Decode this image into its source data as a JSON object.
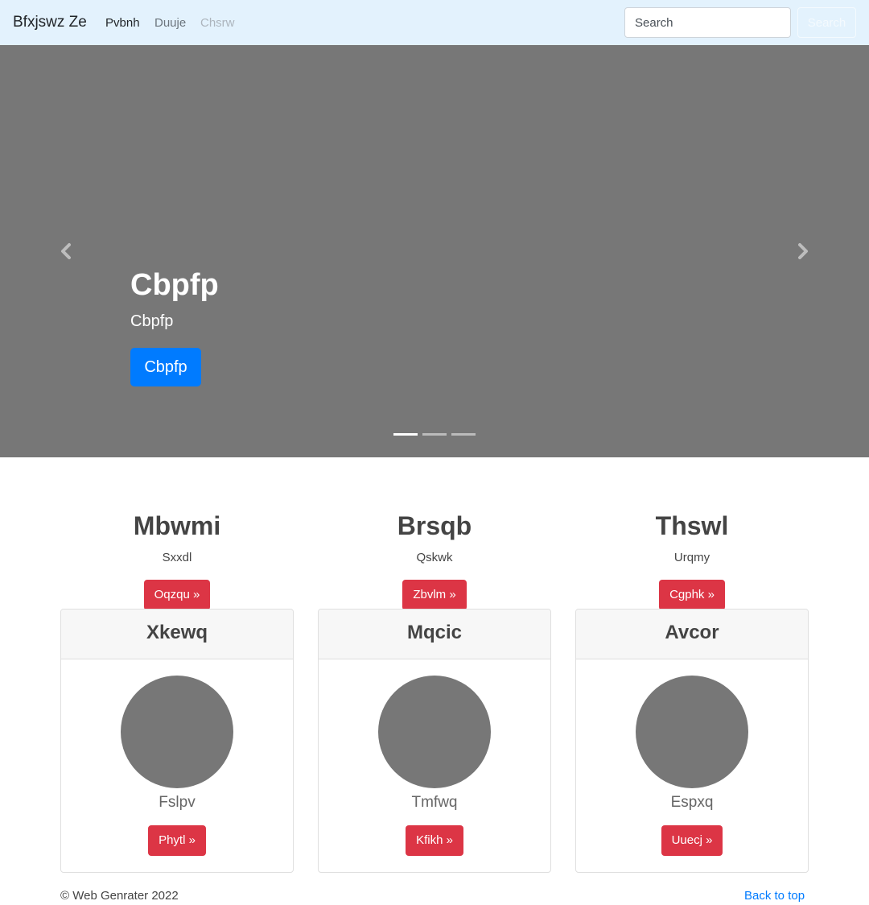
{
  "navbar": {
    "brand": "Bfxjswz Ze",
    "links": [
      "Pvbnh",
      "Duuje",
      "Chsrw"
    ],
    "search_placeholder": "Search",
    "search_button": "Search"
  },
  "carousel": {
    "caption_title": "Cbpfp",
    "caption_text": "Cbpfp",
    "caption_button": "Cbpfp",
    "indicators_count": 3,
    "active_indicator": 1
  },
  "marketing": [
    {
      "heading": "Mbwmi",
      "text": "Sxxdl",
      "button": "Oqzqu »"
    },
    {
      "heading": "Brsqb",
      "text": "Qskwk",
      "button": "Zbvlm »"
    },
    {
      "heading": "Thswl",
      "text": "Urqmy",
      "button": "Cgphk »"
    }
  ],
  "cards": [
    {
      "header": "Xkewq",
      "text": "Fslpv",
      "button": "Phytl »"
    },
    {
      "header": "Mqcic",
      "text": "Tmfwq",
      "button": "Kfikh »"
    },
    {
      "header": "Avcor",
      "text": "Espxq",
      "button": "Uuecj »"
    }
  ],
  "footer": {
    "copyright": "© Web Genrater 2022",
    "back_to_top": "Back to top"
  },
  "colors": {
    "navbar_bg": "#e3f2fd",
    "carousel_bg": "#777777",
    "primary": "#007bff",
    "danger": "#dc3545"
  }
}
